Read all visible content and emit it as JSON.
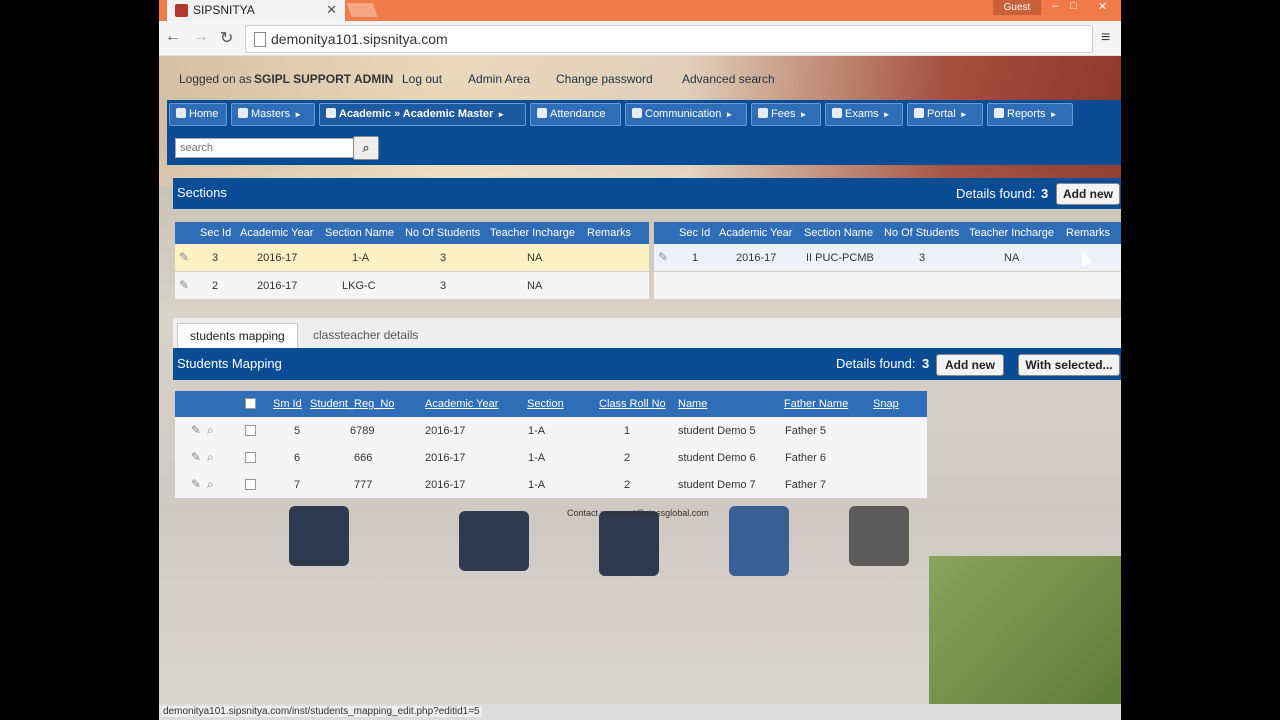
{
  "browser": {
    "tab_title": "SIPSNITYA",
    "guest_label": "Guest",
    "url": "demonitya101.sipsnitya.com",
    "status_url": "demonitya101.sipsnitya.com/inst/students_mapping_edit.php?editid1=5"
  },
  "topbar": {
    "logged_prefix": "Logged on as",
    "user": "SGIPL SUPPORT ADMIN",
    "logout": "Log out",
    "admin_area": "Admin Area",
    "change_password": "Change password",
    "advanced_search": "Advanced search"
  },
  "menu": [
    {
      "label": "Home"
    },
    {
      "label": "Masters"
    },
    {
      "label": "Academic » Academic Master"
    },
    {
      "label": "Attendance"
    },
    {
      "label": "Communication"
    },
    {
      "label": "Fees"
    },
    {
      "label": "Exams"
    },
    {
      "label": "Portal"
    },
    {
      "label": "Reports"
    }
  ],
  "search": {
    "placeholder": "search"
  },
  "sections": {
    "title": "Sections",
    "details_label": "Details found:",
    "details_count": "3",
    "add_new": "Add new",
    "headers": [
      "Sec Id",
      "Academic Year",
      "Section Name",
      "No Of Students",
      "Teacher Incharge",
      "Remarks"
    ],
    "left_rows": [
      {
        "sec_id": "3",
        "year": "2016-17",
        "name": "1-A",
        "students": "3",
        "teacher": "NA",
        "remarks": ""
      },
      {
        "sec_id": "2",
        "year": "2016-17",
        "name": "LKG-C",
        "students": "3",
        "teacher": "NA",
        "remarks": ""
      }
    ],
    "right_rows": [
      {
        "sec_id": "1",
        "year": "2016-17",
        "name": "II PUC-PCMB",
        "students": "3",
        "teacher": "NA",
        "remarks": ""
      }
    ]
  },
  "tabs": {
    "students_mapping": "students mapping",
    "classteacher": "classteacher details"
  },
  "mapping": {
    "title": "Students Mapping",
    "details_label": "Details found:",
    "details_count": "3",
    "add_new": "Add new",
    "with_selected": "With selected...",
    "headers": [
      "Sm Id",
      "Student_Reg_No",
      "Academic Year",
      "Section",
      "Class Roll No",
      "Name",
      "Father Name",
      "Snap"
    ],
    "rows": [
      {
        "sm_id": "5",
        "reg": "6789",
        "year": "2016-17",
        "section": "1-A",
        "roll": "1",
        "name": "student Demo 5",
        "father": "Father 5"
      },
      {
        "sm_id": "6",
        "reg": "666",
        "year": "2016-17",
        "section": "1-A",
        "roll": "2",
        "name": "student Demo 6",
        "father": "Father 6"
      },
      {
        "sm_id": "7",
        "reg": "777",
        "year": "2016-17",
        "section": "1-A",
        "roll": "2",
        "name": "student Demo 7",
        "father": "Father 7"
      }
    ]
  },
  "footer": {
    "contact": "Contact : support@sipssglobal.com"
  },
  "colors": {
    "header_blue": "#0a4d96",
    "menu_blue": "#2f6eb6",
    "highlight_row": "#fbf1c3",
    "titlebar": "#f07a4a"
  }
}
